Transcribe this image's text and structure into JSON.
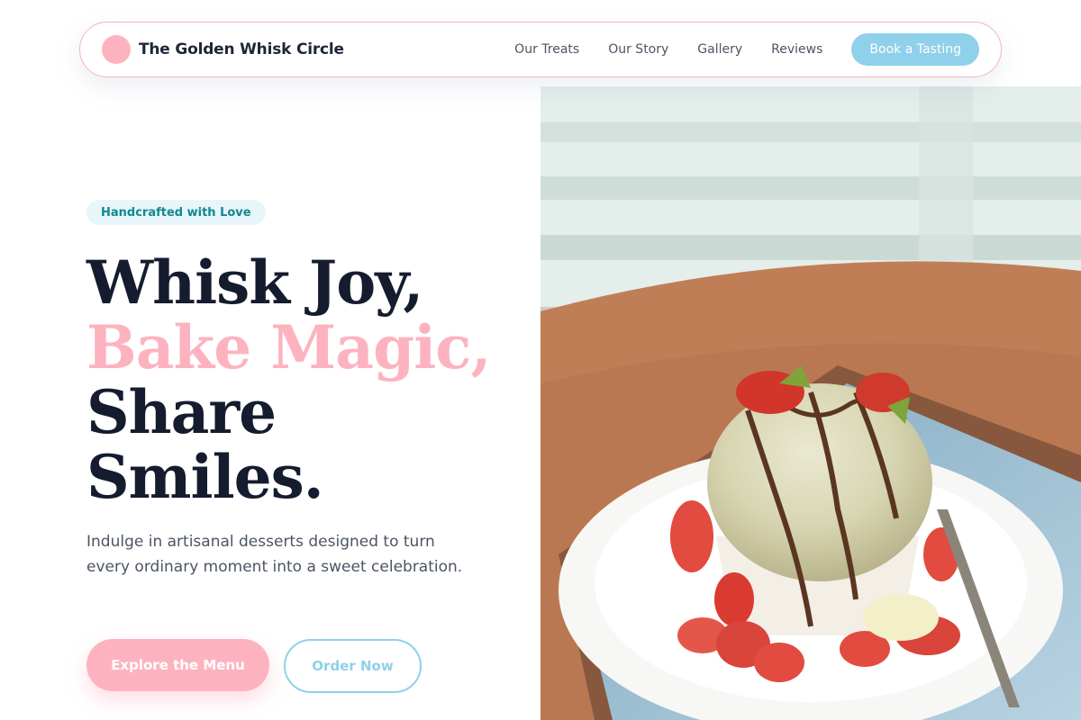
{
  "nav": {
    "brand": "The Golden Whisk Circle",
    "links": [
      "Our Treats",
      "Our Story",
      "Gallery",
      "Reviews"
    ],
    "cta": "Book a Tasting"
  },
  "hero": {
    "badge": "Handcrafted with Love",
    "headline": {
      "line1": "Whisk Joy,",
      "line2": "Bake Magic,",
      "line3": "Share",
      "line4": "Smiles."
    },
    "subtext": "Indulge in artisanal desserts designed to turn every ordinary moment into a sweet celebration.",
    "primary_button": "Explore the Menu",
    "secondary_button": "Order Now",
    "image_subject": "ice cream sundae with strawberries and chocolate drizzle on white plate"
  },
  "colors": {
    "brand_pink": "#fdb3bf",
    "brand_blue": "#8fd0ea",
    "heading_dark": "#141c2e",
    "badge_teal": "#0f8a8f",
    "badge_bg": "#e8f5fa"
  },
  "icons": {
    "logo": "logo-circle-icon"
  }
}
